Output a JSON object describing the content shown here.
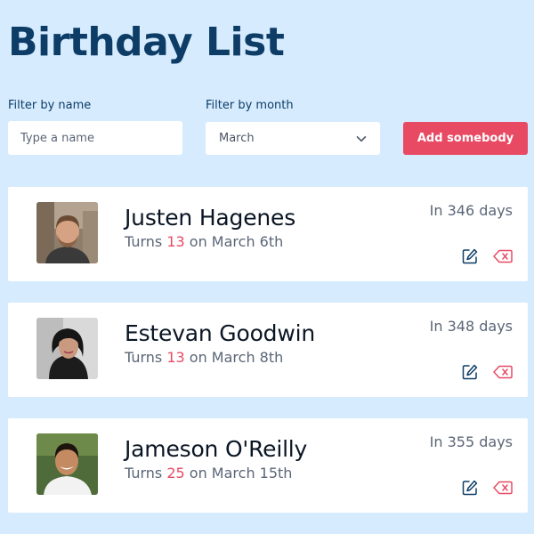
{
  "header": {
    "title": "Birthday List"
  },
  "filters": {
    "name_label": "Filter by name",
    "name_placeholder": "Type a name",
    "month_label": "Filter by month",
    "month_selected": "March"
  },
  "actions": {
    "add_label": "Add somebody"
  },
  "birthdays": [
    {
      "name": "Justen Hagenes",
      "turns_prefix": "Turns ",
      "age": "13",
      "date_text": " on March 6th",
      "days_away": "In 346 days"
    },
    {
      "name": "Estevan Goodwin",
      "turns_prefix": "Turns ",
      "age": "13",
      "date_text": " on March 8th",
      "days_away": "In 348 days"
    },
    {
      "name": "Jameson O'Reilly",
      "turns_prefix": "Turns ",
      "age": "25",
      "date_text": " on March 15th",
      "days_away": "In 355 days"
    }
  ],
  "icons": {
    "edit": "edit-icon",
    "delete": "delete-icon",
    "dropdown": "chevron-down-icon"
  },
  "colors": {
    "background": "#d6ebfe",
    "title": "#0d3d66",
    "accent": "#e84a63",
    "muted": "#5b6677"
  }
}
